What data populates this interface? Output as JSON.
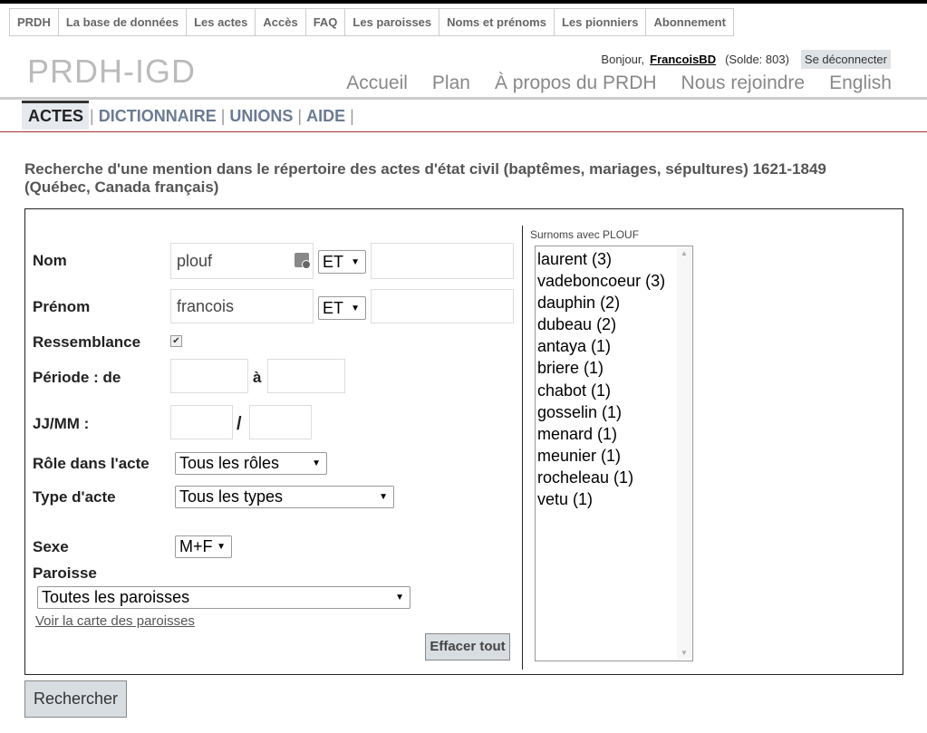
{
  "topnav": [
    "PRDH",
    "La base de données",
    "Les actes",
    "Accès",
    "FAQ",
    "Les paroisses",
    "Noms et prénoms",
    "Les pionniers",
    "Abonnement"
  ],
  "logo": "PRDH-IGD",
  "greeting": {
    "hello": "Bonjour,",
    "user": "FrancoisBD",
    "solde": "(Solde: 803)",
    "logout": "Se déconnecter"
  },
  "mainnav": [
    "Accueil",
    "Plan",
    "À propos du PRDH",
    "Nous rejoindre",
    "English"
  ],
  "subnav": [
    "ACTES",
    "DICTIONNAIRE",
    "UNIONS",
    "AIDE"
  ],
  "title": "Recherche d'une mention dans le répertoire des actes d'état civil (baptêmes, mariages, sépultures) 1621-1849 (Québec, Canada français)",
  "form": {
    "nom_label": "Nom",
    "nom_value": "plouf",
    "nom_op": "ET",
    "nom_extra": "",
    "prenom_label": "Prénom",
    "prenom_value": "francois",
    "prenom_op": "ET",
    "prenom_extra": "",
    "ressemblance_label": "Ressemblance",
    "ressemblance_checked": true,
    "periode_label": "Période : de",
    "periode_a": "à",
    "periode_from": "",
    "periode_to": "",
    "jjmm_label": "JJ/MM :",
    "jjmm_sep": "/",
    "jj": "",
    "mm": "",
    "role_label": "Rôle dans l'acte",
    "role_value": "Tous les rôles",
    "type_label": "Type d'acte",
    "type_value": "Tous les types",
    "sexe_label": "Sexe",
    "sexe_value": "M+F",
    "paroisse_label": "Paroisse",
    "paroisse_value": "Toutes les paroisses",
    "carte_link": "Voir la carte des paroisses",
    "clear_button": "Effacer tout"
  },
  "surnoms": {
    "label": "Surnoms avec PLOUF",
    "items": [
      "laurent (3)",
      "vadeboncoeur (3)",
      "dauphin (2)",
      "dubeau (2)",
      "antaya (1)",
      "briere (1)",
      "chabot (1)",
      "gosselin (1)",
      "menard (1)",
      "meunier (1)",
      "rocheleau (1)",
      "vetu (1)"
    ]
  },
  "search_button": "Rechercher"
}
